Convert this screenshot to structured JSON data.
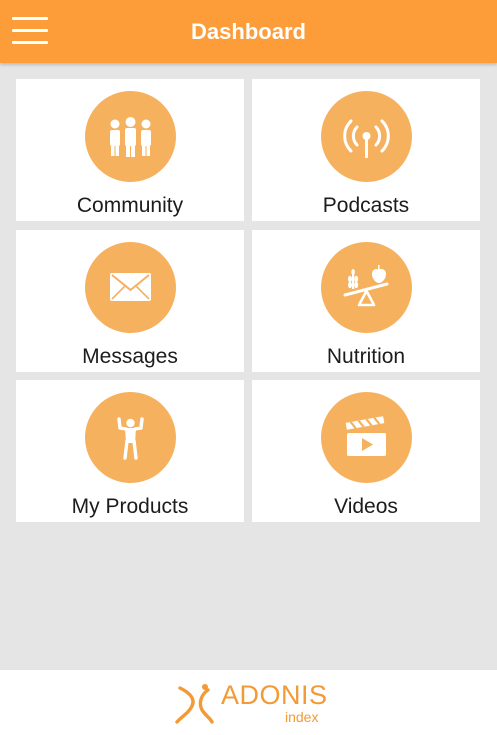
{
  "header": {
    "title": "Dashboard",
    "menu_icon": "hamburger-menu-icon"
  },
  "tiles": [
    {
      "label": "Community",
      "icon": "community-icon"
    },
    {
      "label": "Podcasts",
      "icon": "broadcast-icon"
    },
    {
      "label": "Messages",
      "icon": "envelope-icon"
    },
    {
      "label": "Nutrition",
      "icon": "scale-balance-icon"
    },
    {
      "label": "My Products",
      "icon": "strongman-icon"
    },
    {
      "label": "Videos",
      "icon": "clapperboard-icon"
    }
  ],
  "footer": {
    "brand_name": "ADONIS",
    "brand_sub": "index"
  },
  "colors": {
    "accent": "#fc9d3a",
    "icon_circle": "#f6b15e",
    "background": "#e5e5e5",
    "tile": "#ffffff"
  }
}
